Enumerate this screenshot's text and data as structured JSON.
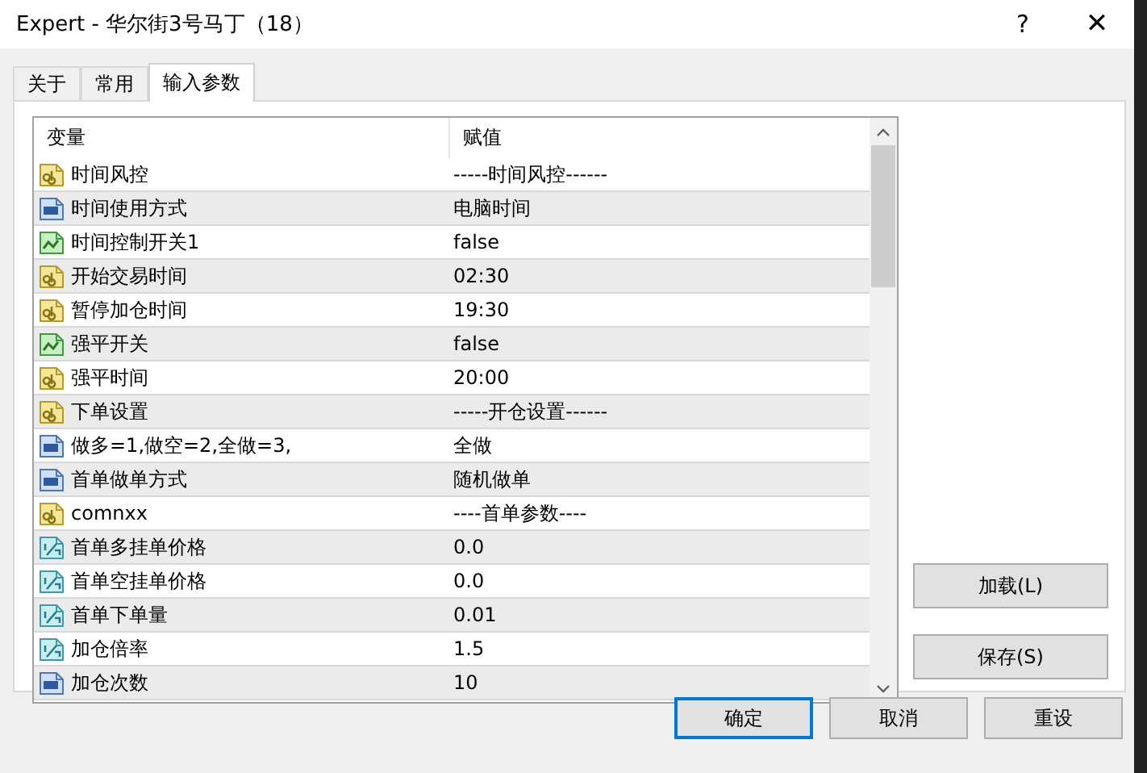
{
  "window": {
    "title": "Expert - 华尔街3号马丁（18）",
    "help": "?",
    "close": "✕"
  },
  "tabs": [
    {
      "label": "关于",
      "selected": false
    },
    {
      "label": "常用",
      "selected": false
    },
    {
      "label": "输入参数",
      "selected": true
    }
  ],
  "table": {
    "columns": [
      "变量",
      "赋值"
    ],
    "rows": [
      {
        "kind": "string",
        "name": "时间风控",
        "value": "-----时间风控------"
      },
      {
        "kind": "int",
        "name": "时间使用方式",
        "value": "电脑时间"
      },
      {
        "kind": "bool",
        "name": "时间控制开关1",
        "value": "false"
      },
      {
        "kind": "string",
        "name": "开始交易时间",
        "value": "02:30"
      },
      {
        "kind": "string",
        "name": "暂停加仓时间",
        "value": "19:30"
      },
      {
        "kind": "bool",
        "name": "强平开关",
        "value": "false"
      },
      {
        "kind": "string",
        "name": "强平时间",
        "value": "20:00"
      },
      {
        "kind": "string",
        "name": "下单设置",
        "value": "-----开仓设置------"
      },
      {
        "kind": "int",
        "name": "做多=1,做空=2,全做=3,",
        "value": "全做"
      },
      {
        "kind": "int",
        "name": "首单做单方式",
        "value": "随机做单"
      },
      {
        "kind": "string",
        "name": "comnxx",
        "value": "----首单参数----"
      },
      {
        "kind": "double",
        "name": "首单多挂单价格",
        "value": "0.0"
      },
      {
        "kind": "double",
        "name": "首单空挂单价格",
        "value": "0.0"
      },
      {
        "kind": "double",
        "name": "首单下单量",
        "value": "0.01"
      },
      {
        "kind": "double",
        "name": "加仓倍率",
        "value": "1.5"
      },
      {
        "kind": "int",
        "name": "加仓次数",
        "value": "10"
      }
    ]
  },
  "side_buttons": [
    "加载(L)",
    "保存(S)"
  ],
  "buttons": [
    {
      "label": "确定",
      "default": true
    },
    {
      "label": "取消",
      "default": false
    },
    {
      "label": "重设",
      "default": false
    }
  ]
}
